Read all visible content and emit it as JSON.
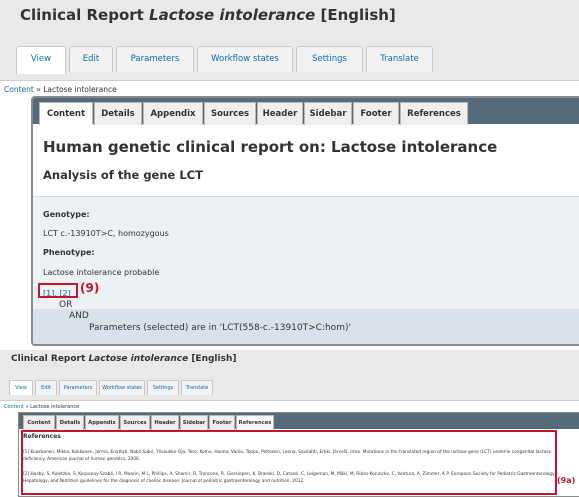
{
  "top": {
    "title_prefix": "Clinical Report ",
    "title_italic": "Lactose intolerance",
    "title_suffix": " [English]",
    "main_tabs": [
      "View",
      "Edit",
      "Parameters",
      "Workflow states",
      "Settings",
      "Translate"
    ],
    "breadcrumb_link": "Content",
    "breadcrumb_sep": " » ",
    "breadcrumb_current": "Lactose intolerance",
    "sub_tabs": [
      "Content",
      "Details",
      "Appendix",
      "Sources",
      "Header",
      "Sidebar",
      "Footer",
      "References"
    ],
    "heading": "Human genetic clinical report on: Lactose intolerance",
    "subheading": "Analysis of the gene LCT",
    "genotype_label": "Genotype:",
    "genotype_value": "LCT c.-13910T>C, homozygous",
    "phenotype_label": "Phenotype:",
    "phenotype_value": "Lactose intolerance probable",
    "ref_links": "[1], [2]",
    "annotation": "(9)",
    "logic_or": "OR",
    "logic_and": "AND",
    "logic_params": "Parameters (selected) are in 'LCT(558-c.-13910T>C:hom)'"
  },
  "bottom": {
    "title_prefix": "Clinical Report ",
    "title_italic": "Lactose intolerance",
    "title_suffix": " [English]",
    "main_tabs": [
      "View",
      "Edit",
      "Parameters",
      "Workflow states",
      "Settings",
      "Translate"
    ],
    "breadcrumb_link": "Content",
    "breadcrumb_sep": " » ",
    "breadcrumb_current": "Lactose intolerance",
    "sub_tabs": [
      "Content",
      "Details",
      "Appendix",
      "Sources",
      "Header",
      "Sidebar",
      "Footer",
      "References"
    ],
    "references_heading": "References",
    "ref1": "[1] Kuokkanen, Mikko, Kokkonen, Jorma, Enattah, Nabil Sabri, Ylisaukko-Oja, Tero, Komu, Hanna, Varilo, Teppo, Peltonen, Leena, Savilahti, Erkki, Järvelä, Irma. Mutations in the translated region of the lactase gene (LCT) underlie congenital lactase deficiency. American journal of human genetics, 2006.",
    "ref2": "[2] Husby, S, Koletzko, S, Korponay-Szabó, I R, Mearin, M L, Phillips, A, Shamir, R, Troncone, R, Giersiepen, K, Branski, D, Catassi, C, Lelgeman, M, Mäki, M, Ribes-Koninckx, C, Ventura, A, Zimmer, K P. European Society for Pediatric Gastroenterology, Hepatology, and Nutrition guidelines for the diagnosis of coeliac disease. Journal of pediatric gastroenterology and nutrition, 2012.",
    "annotation": "(9a)"
  },
  "colors": {
    "link": "#0a6ea8",
    "tabbar": "#566b7a",
    "highlight": "#c0182a"
  }
}
